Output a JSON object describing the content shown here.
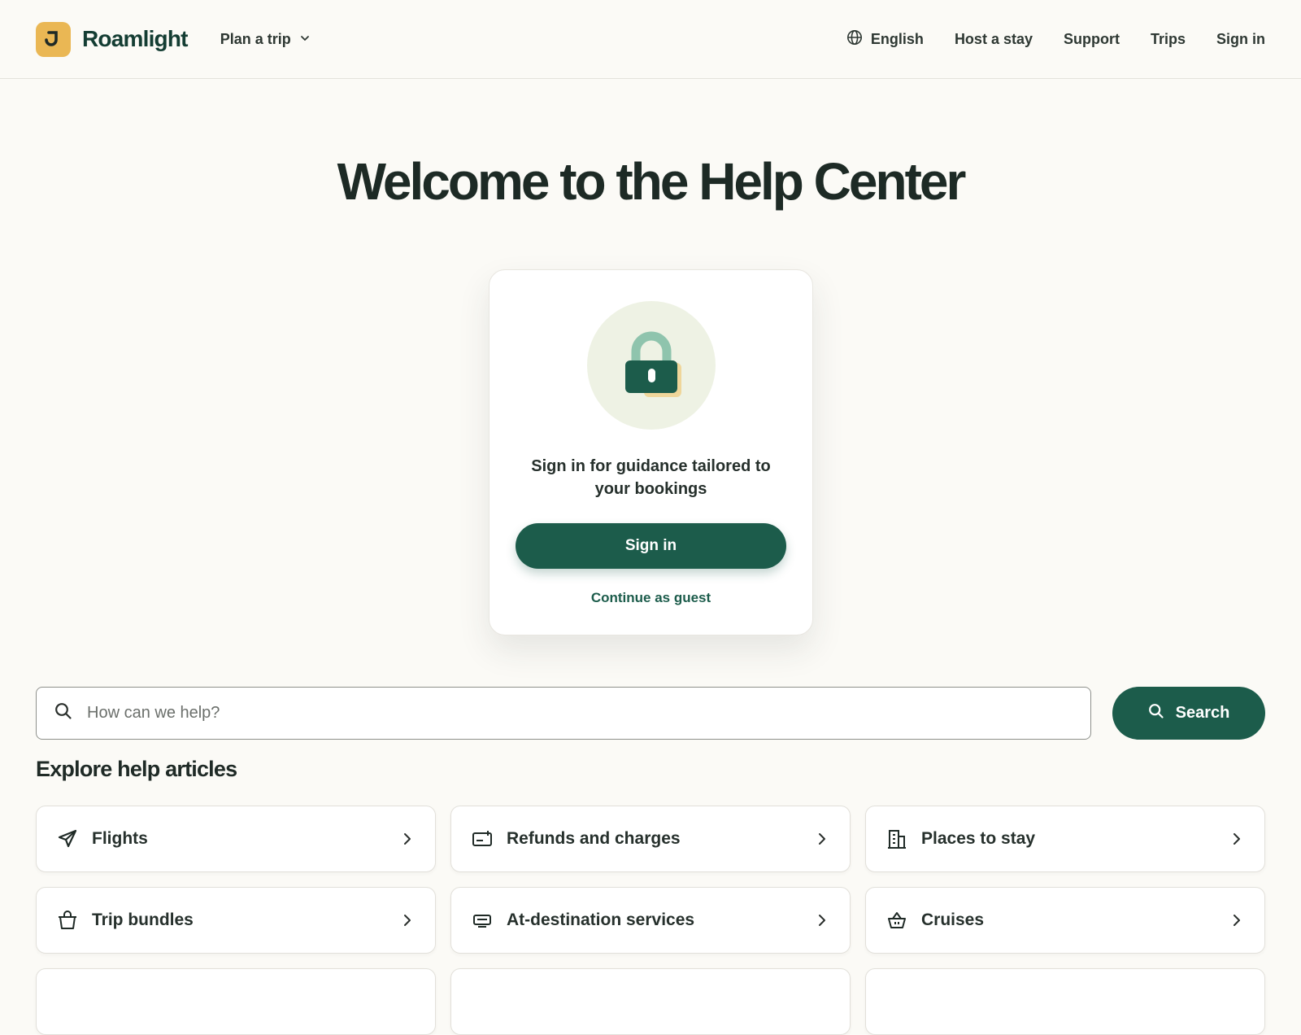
{
  "header": {
    "brand": "Roamlight",
    "plan_trip": "Plan a trip",
    "nav": {
      "language": "English",
      "host": "Host a stay",
      "support": "Support",
      "trips": "Trips",
      "sign_in": "Sign in"
    }
  },
  "hero": {
    "title": "Welcome to the Help Center"
  },
  "signin_card": {
    "message": "Sign in for guidance tailored to your bookings",
    "button": "Sign in",
    "guest_link": "Continue as guest"
  },
  "search": {
    "placeholder": "How can we help?",
    "button": "Search"
  },
  "articles": {
    "heading": "Explore help articles",
    "topics": [
      {
        "label": "Flights",
        "icon": "plane-icon"
      },
      {
        "label": "Refunds and charges",
        "icon": "ticket-icon"
      },
      {
        "label": "Places to stay",
        "icon": "building-icon"
      },
      {
        "label": "Trip bundles",
        "icon": "bag-icon"
      },
      {
        "label": "At-destination services",
        "icon": "services-icon"
      },
      {
        "label": "Cruises",
        "icon": "basket-icon"
      }
    ]
  },
  "colors": {
    "brand_green": "#1c5c4b",
    "logo_yellow": "#eab754",
    "background": "#fbfaf6"
  }
}
